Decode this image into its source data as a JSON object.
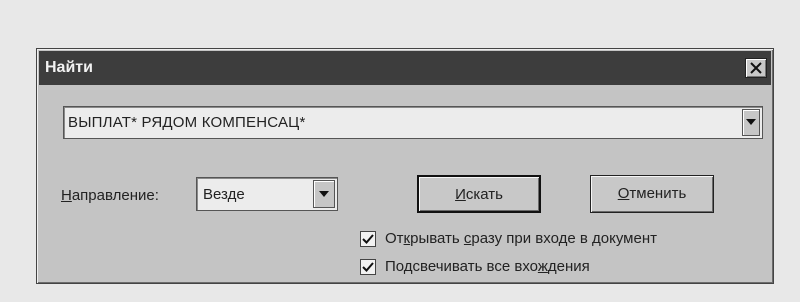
{
  "dialog": {
    "title": "Найти",
    "query_value": "ВЫПЛАТ* РЯДОМ КОМПЕНСАЦ*",
    "direction": {
      "label_mnemonic": "Н",
      "label_rest": "аправление:",
      "selected": "Везде"
    },
    "buttons": {
      "search": {
        "mnemonic": "И",
        "rest": "скать"
      },
      "cancel": {
        "mnemonic": "О",
        "rest": "тменить"
      }
    },
    "options": [
      {
        "pre": "От",
        "mnemonic": "к",
        "mid": "рывать ",
        "mnemonic2": "с",
        "rest": "разу при входе в документ",
        "checked": true
      },
      {
        "pre": "Подсвечивать все вхо",
        "mnemonic": "ж",
        "rest": "дения",
        "checked": true
      }
    ]
  },
  "icons": {
    "close": "close-icon",
    "dropdown": "chevron-down-icon",
    "check": "check-icon"
  }
}
